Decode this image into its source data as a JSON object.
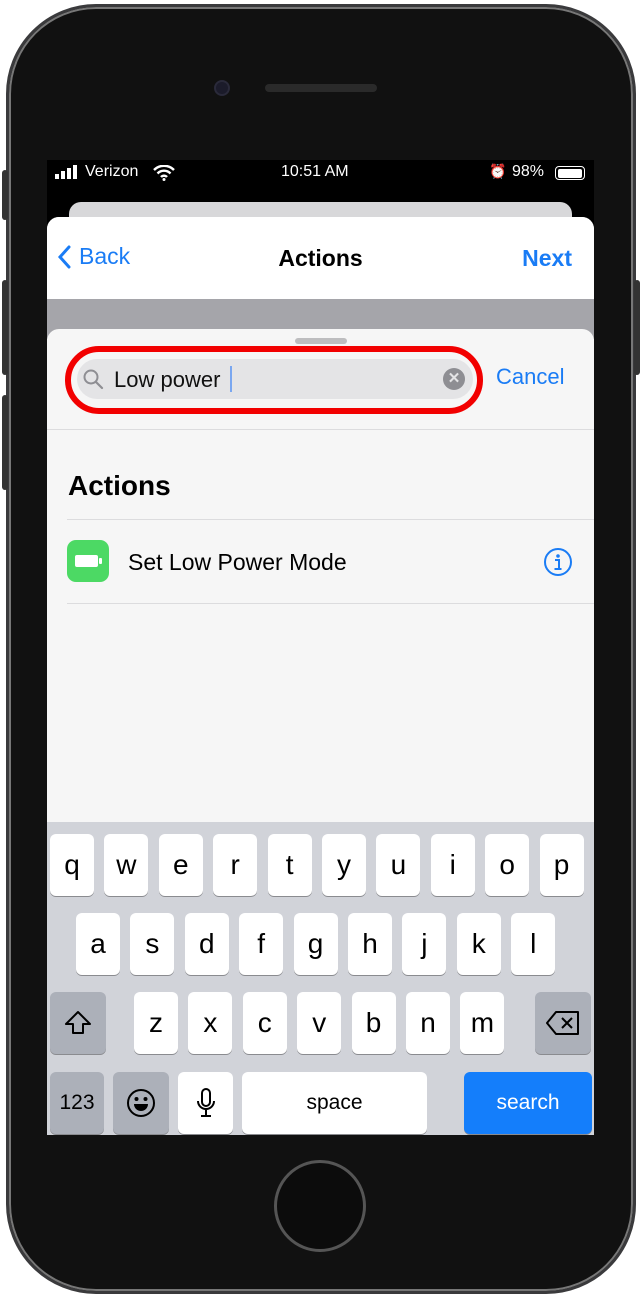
{
  "status_bar": {
    "carrier": "Verizon",
    "time": "10:51 AM",
    "battery": "98%",
    "battery_level": 0.98
  },
  "nav": {
    "back_label": "Back",
    "title": "Actions",
    "next_label": "Next"
  },
  "search": {
    "value": "Low power",
    "cancel_label": "Cancel"
  },
  "results": {
    "section_title": "Actions",
    "items": [
      {
        "label": "Set Low Power Mode",
        "icon": "battery-icon",
        "icon_color": "#4cd964"
      }
    ]
  },
  "keyboard": {
    "rows": [
      [
        "q",
        "w",
        "e",
        "r",
        "t",
        "y",
        "u",
        "i",
        "o",
        "p"
      ],
      [
        "a",
        "s",
        "d",
        "f",
        "g",
        "h",
        "j",
        "k",
        "l"
      ],
      [
        "z",
        "x",
        "c",
        "v",
        "b",
        "n",
        "m"
      ]
    ],
    "numbers_label": "123",
    "space_label": "space",
    "search_label": "search"
  },
  "colors": {
    "accent": "#1a7cf5",
    "highlight": "#f20000",
    "search_key": "#147efb"
  }
}
